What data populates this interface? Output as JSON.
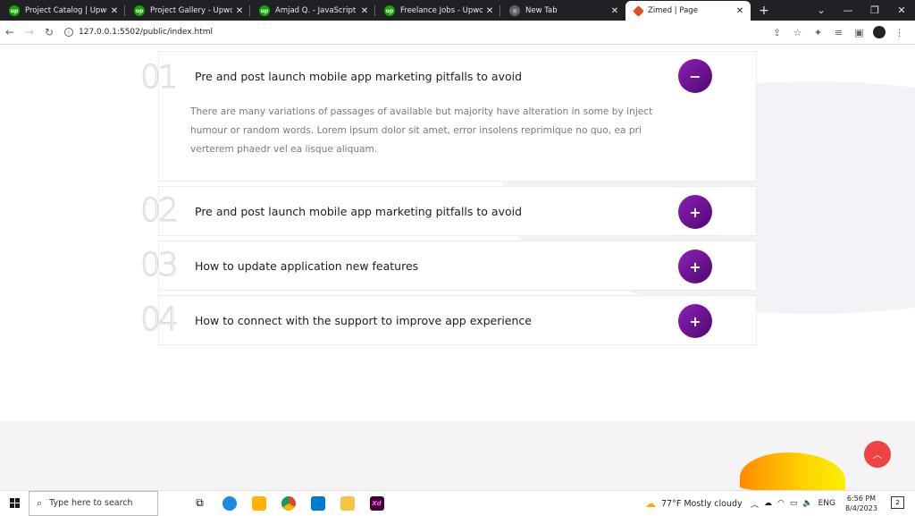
{
  "browser": {
    "tabs": [
      {
        "title": "Project Catalog | Upwork",
        "icon": "upwork-icon"
      },
      {
        "title": "Project Gallery - Upwork C",
        "icon": "upwork-icon"
      },
      {
        "title": "Amjad Q. - JavaScript | Htm",
        "icon": "upwork-icon"
      },
      {
        "title": "Freelance Jobs - Upwork",
        "icon": "upwork-icon"
      },
      {
        "title": "New Tab",
        "icon": "globe-icon"
      },
      {
        "title": "Zimed | Page",
        "icon": "zimed-icon",
        "active": true
      }
    ],
    "new_tab_symbol": "+",
    "url": "127.0.0.1:5502/public/index.html"
  },
  "faq": {
    "items": [
      {
        "number": "01",
        "question": "Pre and post launch mobile app marketing pitfalls to avoid",
        "toggle": "−",
        "expanded": true,
        "answer": "There are many variations of passages of available but majority have alteration in some by inject humour or random words. Lorem ipsum dolor sit amet, error insolens reprimique no quo, ea pri verterem phaedr vel ea iisque aliquam."
      },
      {
        "number": "02",
        "question": "Pre and post launch mobile app marketing pitfalls to avoid",
        "toggle": "+",
        "expanded": false
      },
      {
        "number": "03",
        "question": "How to update application new features",
        "toggle": "+",
        "expanded": false
      },
      {
        "number": "04",
        "question": "How to connect with the support to improve app experience",
        "toggle": "+",
        "expanded": false
      }
    ],
    "accent_gradient": [
      "#8e1fb8",
      "#4d0a6e"
    ]
  },
  "scroll_top_color": "#ef4242",
  "taskbar": {
    "search_placeholder": "Type here to search",
    "weather": "77°F  Mostly cloudy",
    "language": "ENG",
    "time": "6:56 PM",
    "date": "8/4/2023",
    "notifications": "2",
    "xd_label": "Xd"
  }
}
